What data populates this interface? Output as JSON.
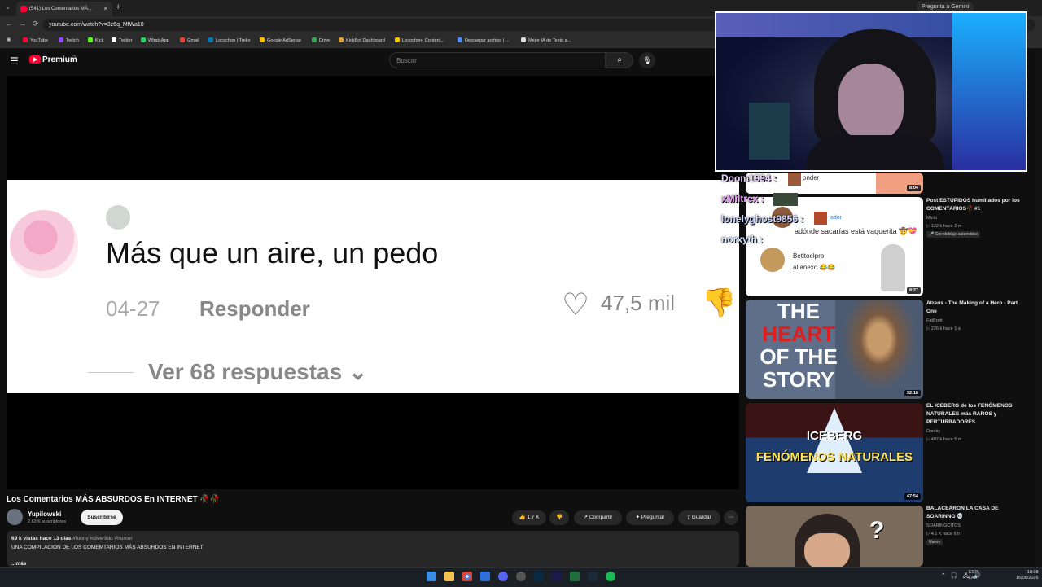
{
  "browser": {
    "tab_title": "(541) Los Comentarios MÁ...",
    "url": "youtube.com/watch?v=3z6q_MfWa10",
    "gemini_label": "Pregunta a Gemini",
    "bookmarks": [
      "YouTube",
      "Twitch",
      "Kick",
      "Twitter",
      "WhatsApp",
      "Gmail",
      "Locochon | Trello",
      "Google AdSense",
      "Drive",
      "KickBot Dashboard",
      "Locochon- Content...",
      "Descargar archivo | ...",
      "Mejor IA de Texto a..."
    ]
  },
  "youtube": {
    "logo_text": "Premium",
    "logo_sup": "PE",
    "search_placeholder": "Buscar"
  },
  "video_frame": {
    "comment_text": "Más que un aire, un pedo",
    "date": "04-27",
    "reply": "Responder",
    "likes": "47,5 mil",
    "replies": "Ver 68 respuestas ⌄"
  },
  "video": {
    "title": "Los Comentarios MÁS ABSURDOS En INTERNET 🥀🥀",
    "channel": "Yupilowski",
    "subscribers": "2.63 K suscriptores",
    "subscribe": "Suscribirse",
    "likes": "1.7 K",
    "share": "Compartir",
    "ask": "Preguntar",
    "save": "Guardar",
    "views_date": "69 k vistas  hace 13 días",
    "hashtags": "#funny #divertido #humor",
    "description": "UNA COMPILACIÓN DE LOS COMEMTARIOS MÁS ABSURDOS EN INTERNET",
    "more": "...más"
  },
  "chat": [
    {
      "user": "Doom1994 :",
      "color": "#d9c4ff"
    },
    {
      "user": "xMiltrex :",
      "color": "#f0a8ff"
    },
    {
      "user": "lonelyghost9856 :",
      "color": "#c9d9ff"
    },
    {
      "user": "norxyth :",
      "color": "#d2e6ff"
    }
  ],
  "sidebar": [
    {
      "title": "",
      "channel": "",
      "meta": "",
      "duration": "8:04"
    },
    {
      "title": "Post ESTUPIDOS humillados por los COMENTARIOS🥀 #1",
      "channel": "Michi",
      "meta": "▷ 122 k  hace 2 m",
      "badge": "🎤 Con doblaje automático",
      "duration": "8:27",
      "thumb_text_1": "adónde sacarías está vaquerita 🤠💝",
      "thumb_text_2": "Betitoelpro",
      "thumb_text_3": "al anexo 😂😂",
      "thumb_text_4": "onder",
      "thumb_text_5": "ador"
    },
    {
      "title": "Atreus - The Making of a Hero - Part One",
      "channel": "FatBrett",
      "meta": "▷ 226 k  hace 1 a",
      "duration": "32:18",
      "thumb_lines": [
        "THE",
        "HEART",
        "OF THE",
        "STORY"
      ]
    },
    {
      "title": "EL ICEBERG de los FENÓMENOS NATURALES más RAROS y PERTURBADORES",
      "channel": "Dorcky",
      "meta": "▷ 407 k  hace 5 m",
      "duration": "47:54",
      "thumb_lines": [
        "ICEBERG",
        "FENÓMENOS NATURALES"
      ]
    },
    {
      "title": "BALACEARON LA CASA DE SOARINNG 💀",
      "channel": "SOARINGCITOS",
      "meta": "▷ 4.1 K  hace 6 h",
      "badge": "Nuevo"
    }
  ],
  "taskbar": {
    "lang_1": "ESP",
    "lang_2": "LAA",
    "time": "18:08",
    "date": "16/08/2026"
  }
}
